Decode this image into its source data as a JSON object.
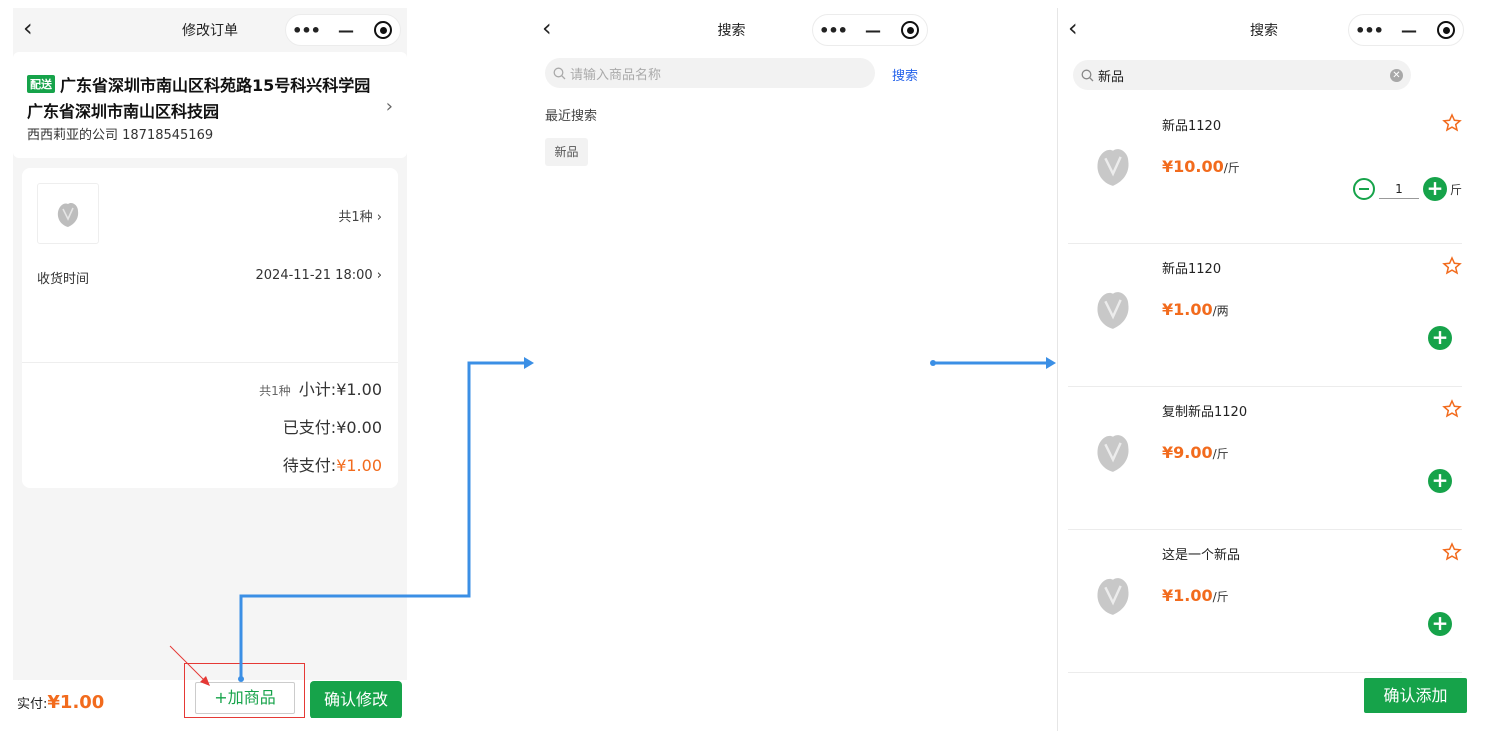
{
  "screen1": {
    "nav_title": "修改订单",
    "address": {
      "badge": "配送",
      "line1": "广东省深圳市南山区科苑路15号科兴科学园",
      "line2": "广东省深圳市南山区科技园",
      "contact": "西西莉亚的公司  18718545169"
    },
    "order": {
      "kinds_link": "共1种",
      "delivery_label": "收货时间",
      "delivery_value": "2024-11-21 18:00",
      "kinds_small": "共1种",
      "subtotal": "小计:¥1.00",
      "paid": "已支付:¥0.00",
      "pending_label": "待支付:",
      "pending_value": "¥1.00"
    },
    "bottom": {
      "paid_label": "实付:",
      "paid_value": "¥1.00",
      "add_goods": "+加商品",
      "confirm_edit": "确认修改"
    }
  },
  "screen2": {
    "nav_title": "搜索",
    "search_placeholder": "请输入商品名称",
    "search_button": "搜索",
    "recent_title": "最近搜索",
    "recent_items": [
      "新品"
    ]
  },
  "screen3": {
    "nav_title": "搜索",
    "search_value": "新品",
    "products": [
      {
        "name": "新品1120",
        "price": "¥10.00",
        "unit": "/斤",
        "quantity": "1",
        "qty_unit": "斤"
      },
      {
        "name": "新品1120",
        "price": "¥1.00",
        "unit": "/两"
      },
      {
        "name": "复制新品1120",
        "price": "¥9.00",
        "unit": "/斤"
      },
      {
        "name": "这是一个新品",
        "price": "¥1.00",
        "unit": "/斤"
      }
    ],
    "confirm_add": "确认添加"
  },
  "colors": {
    "accent_green": "#16a34a",
    "price_orange": "#f26b1d",
    "arrow_blue": "#3b8fe5",
    "highlight_red": "#e53935"
  }
}
